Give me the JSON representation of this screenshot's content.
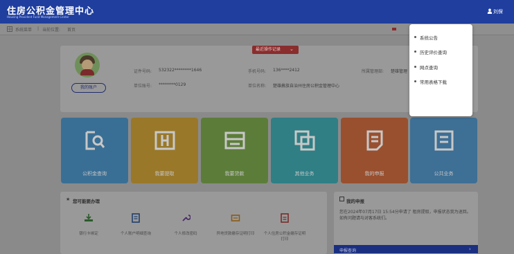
{
  "header": {
    "title": "住房公积金管理中心",
    "subtitle": "Housing Provident Fund Management Center",
    "user": "刘保"
  },
  "breadcrumb": {
    "menu": "系统菜单",
    "separator": "|",
    "position_label": "当前位置:",
    "home": "首页"
  },
  "account": {
    "my_account_label": "我的账户",
    "recent_ops_label": "最近操作记录",
    "id_label": "证件号码:",
    "id_value": "532322********1646",
    "phone_label": "手机号码:",
    "phone_value": "136****2412",
    "manager_label": "所属管理部:",
    "manager_value": "楚雄管理",
    "unit_account_label": "单位账号:",
    "unit_account_value": "********0129",
    "unit_name_label": "单位名称:",
    "unit_name_value": "楚雄彝族自治州住房公积金管理中心"
  },
  "tiles": [
    {
      "label": "公积金查询"
    },
    {
      "label": "我要提取"
    },
    {
      "label": "我要贷款"
    },
    {
      "label": "其他业务"
    },
    {
      "label": "我的申报"
    },
    {
      "label": "公共业务"
    }
  ],
  "dropdown": {
    "items": [
      "系统公告",
      "历史评价查询",
      "网点查询",
      "常用表格下载"
    ]
  },
  "todo": {
    "title": "您可能要办理",
    "items": [
      {
        "label": "银行卡绑定"
      },
      {
        "label": "个人账户明细查询"
      },
      {
        "label": "个人修改密码"
      },
      {
        "label": "异地贷款缴存证明打印"
      },
      {
        "label": "个人住房公积金缴存证明打印"
      }
    ]
  },
  "report": {
    "title": "我的申报",
    "text": "您在2024年07月17日 15:54分申请了 租房提取，申报状态我为退回。如有问题请与对客系统们。",
    "bar_label": "申报查询",
    "bar_arrow": "›"
  },
  "colors": {
    "header_bg": "#1f3e9e",
    "tile_blue": "#3a6f95",
    "tile_gold": "#99782a",
    "tile_green": "#5c7d3a",
    "tile_teal": "#2f7f85",
    "tile_orange": "#99502f"
  }
}
